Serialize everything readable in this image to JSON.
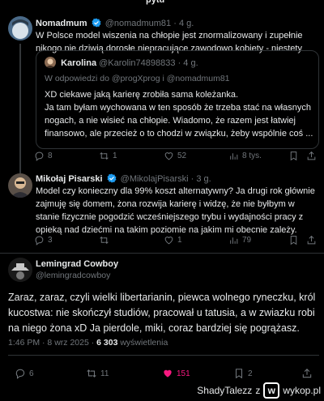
{
  "top_fragment": "pytu",
  "tweet1": {
    "name": "Nomadmum",
    "handle": "@nomadmum81",
    "time": "· 4 g.",
    "text": "W Polsce model wiszenia na chłopie jest znormalizowany i zupełnie nikogo nie dziwią dorosłe niepracujące zawodowo  kobiety - niestety",
    "quote": {
      "name": "Karolina",
      "handle": "@Karolin74898833",
      "time": "· 4 g.",
      "reply_to": "W odpowiedzi do @progXprog i @nomadmum81",
      "text": "XD ciekawe jaką karierę zrobiła sama koleżanka.\nJa tam byłam wychowana w ten sposób że trzeba stać na własnych nogach, a nie wisieć na chłopie. Wiadomo, że razem jest łatwiej finansowo, ale przecież o to chodzi w związku, żeby wspólnie coś ..."
    },
    "replies": "8",
    "retweets": "1",
    "likes": "52",
    "views": "8 tys."
  },
  "tweet2": {
    "name": "Mikołaj Pisarski",
    "handle": "@MikolajPisarski",
    "time": "· 3 g.",
    "text": "Model czy konieczny dla 99% koszt alternatywny? Ja drugi rok głównie zajmuję się domem, żona rozwija karierę i widzę, że nie byłbym w stanie fizycznie pogodzić wcześniejszego trybu i wydajności pracy z opieką nad dziećmi na takim poziomie na jakim mi obecnie zależy.",
    "replies": "3",
    "retweets": "",
    "likes": "1",
    "views": "79"
  },
  "tweet3": {
    "name": "Lemingrad Cowboy",
    "handle": "@lemingradcowboy",
    "text": "Zaraz, zaraz, czyli wielki libertarianin, piewca wolnego ryneczku, król kucostwa: nie skończył studiów, pracował u tatusia, a w zwiazku robi na niego żona xD Ja pierdole, miki, coraz bardziej się pogrążasz.",
    "time": "1:46 PM · 8 wrz 2025 · ",
    "views_count": "6 303",
    "views_label": " wyświetlenia",
    "replies": "6",
    "retweets": "11",
    "likes": "151",
    "bookmarks": "2"
  },
  "watermark": {
    "user": "ShadyTalezz",
    "z": "z",
    "site": "wykop.pl"
  },
  "colors": {
    "verified": "#1d9bf0",
    "liked": "#f91880",
    "muted": "#71767b"
  }
}
